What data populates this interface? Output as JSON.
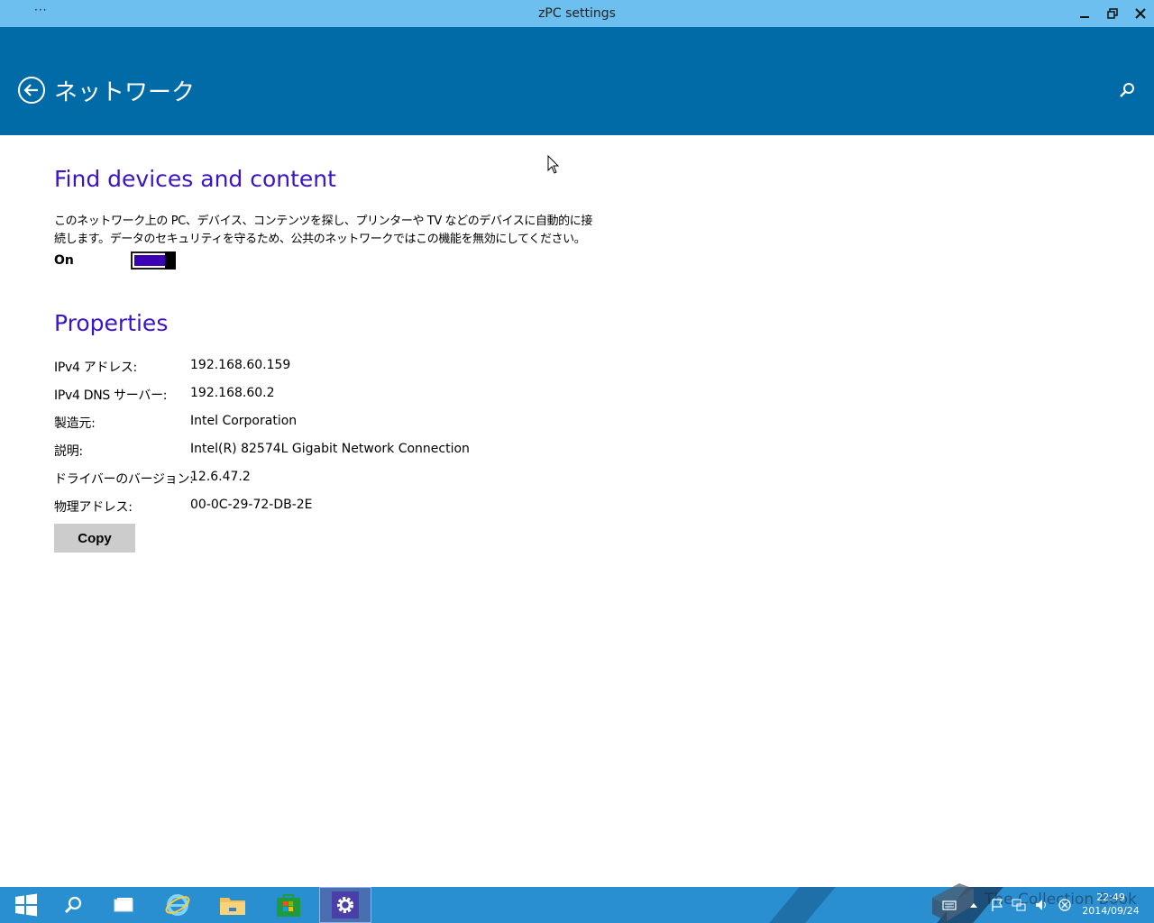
{
  "window": {
    "menu_dots": "···",
    "title": "zPC settings"
  },
  "header": {
    "title": "ネットワーク"
  },
  "find_devices": {
    "heading": "Find devices and content",
    "description": "このネットワーク上の PC、デバイス、コンテンツを探し、プリンターや TV などのデバイスに自動的に接続します。データのセキュリティを守るため、公共のネットワークではこの機能を無効にしてください。",
    "toggle_label": "On",
    "toggle_state": true
  },
  "properties": {
    "heading": "Properties",
    "rows": [
      {
        "label": "IPv4 アドレス:",
        "value": "192.168.60.159"
      },
      {
        "label": "IPv4 DNS サーバー:",
        "value": "192.168.60.2"
      },
      {
        "label": "製造元:",
        "value": "Intel Corporation"
      },
      {
        "label": "説明:",
        "value": "Intel(R) 82574L Gigabit Network Connection"
      },
      {
        "label": "ドライバーのバージョン:",
        "value": "12.6.47.2"
      },
      {
        "label": "物理アドレス:",
        "value": "00-0C-29-72-DB-2E"
      }
    ],
    "copy_label": "Copy"
  },
  "taskbar": {
    "items": [
      "start-icon",
      "search-icon",
      "task-view-icon",
      "internet-explorer-icon",
      "file-explorer-icon",
      "store-icon",
      "settings-icon"
    ],
    "active_item": "settings-icon",
    "watermark": "The Collection Book",
    "clock_time": "22:49",
    "clock_date": "2014/09/24"
  },
  "colors": {
    "titlebar": "#6cbfee",
    "header": "#006ba6",
    "accent": "#3c14c8",
    "toggle_fill": "#3c00b4",
    "taskbar": "#2a8fd0"
  }
}
